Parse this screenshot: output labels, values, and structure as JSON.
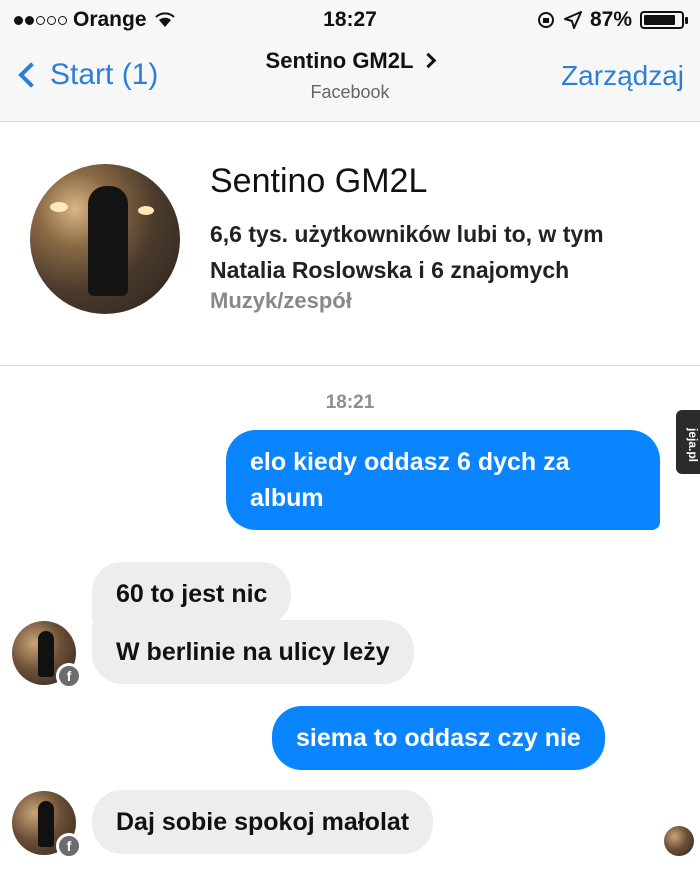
{
  "status_bar": {
    "carrier": "Orange",
    "time": "18:27",
    "battery": "87%",
    "battery_level": 0.87,
    "signal_dots": [
      true,
      true,
      false,
      false,
      false
    ]
  },
  "nav": {
    "back_label": "Start (1)",
    "title": "Sentino GM2L",
    "subtitle": "Facebook",
    "manage_label": "Zarządzaj"
  },
  "page": {
    "name": "Sentino GM2L",
    "likes": "6,6 tys. użytkowników lubi to, w tym Natalia Roslowska i 6 znajomych",
    "category": "Muzyk/zespół"
  },
  "chat": {
    "timestamp": "18:21",
    "messages": [
      {
        "direction": "out",
        "text": "elo kiedy oddasz 6 dych za album"
      },
      {
        "direction": "in",
        "text": "60 to jest nic"
      },
      {
        "direction": "in",
        "text": "W berlinie na ulicy leży"
      },
      {
        "direction": "out",
        "text": "siema to oddasz czy nie"
      },
      {
        "direction": "in",
        "text": "Daj sobie spokoj małolat"
      }
    ]
  },
  "watermark": "jeja.pl",
  "colors": {
    "accent": "#2d7fd6",
    "outgoing_bubble": "#0a84ff",
    "incoming_bubble": "#ededee"
  }
}
